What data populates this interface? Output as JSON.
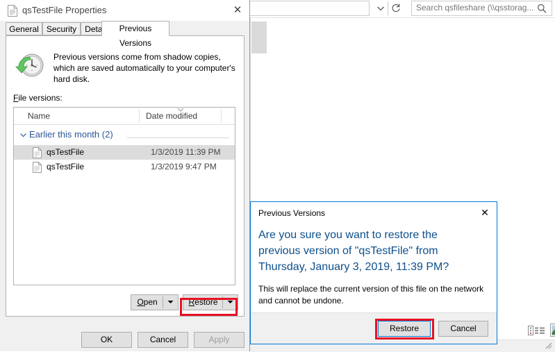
{
  "explorer": {
    "address_chevron_icon": "chevron-down-icon",
    "refresh_icon": "refresh-icon",
    "search_placeholder": "Search qsfileshare (\\\\qsstorag...",
    "search_icon": "search-icon",
    "view_details_icon": "details-view-icon",
    "view_large_icon": "large-icons-view-icon",
    "resize_grip_icon": "resize-grip-icon"
  },
  "properties": {
    "title": "qsTestFile Properties",
    "title_icon": "file-icon",
    "close_label": "✕",
    "tabs": [
      {
        "label": "General",
        "active": false
      },
      {
        "label": "Security",
        "active": false
      },
      {
        "label": "Details",
        "active": false
      },
      {
        "label": "Previous Versions",
        "active": true
      }
    ],
    "info_icon": "clock-restore-icon",
    "info_text": "Previous versions come from shadow copies, which are saved automatically to your computer's hard disk.",
    "file_versions_label": "File versions:",
    "list": {
      "columns": [
        "Name",
        "Date modified"
      ],
      "sort_indicator_icon": "sort-ascending-icon",
      "group": {
        "chevron_icon": "chevron-down-icon",
        "label": "Earlier this month (2)"
      },
      "rows": [
        {
          "icon": "file-icon",
          "name": "qsTestFile",
          "date": "1/3/2019 11:39 PM",
          "selected": true
        },
        {
          "icon": "file-icon",
          "name": "qsTestFile",
          "date": "1/3/2019 9:47 PM",
          "selected": false
        }
      ]
    },
    "open_button": {
      "label": "Open",
      "mnemonic": "O",
      "arrow_icon": "chevron-down-icon"
    },
    "restore_button": {
      "label": "Restore",
      "mnemonic": "R",
      "arrow_icon": "chevron-down-icon",
      "highlighted": true
    },
    "ok_button": "OK",
    "cancel_button": "Cancel",
    "apply_button": "Apply"
  },
  "confirm_dialog": {
    "title": "Previous Versions",
    "close_label": "✕",
    "main_text": "Are you sure you want to restore the previous version of \"qsTestFile\" from Thursday, January 3, 2019, 11:39 PM?",
    "sub_text": "This will replace the current version of this file on the network and cannot be undone.",
    "restore_button": "Restore",
    "cancel_button": "Cancel"
  },
  "highlight_color": "#e81123",
  "accent_color": "#0078d7"
}
